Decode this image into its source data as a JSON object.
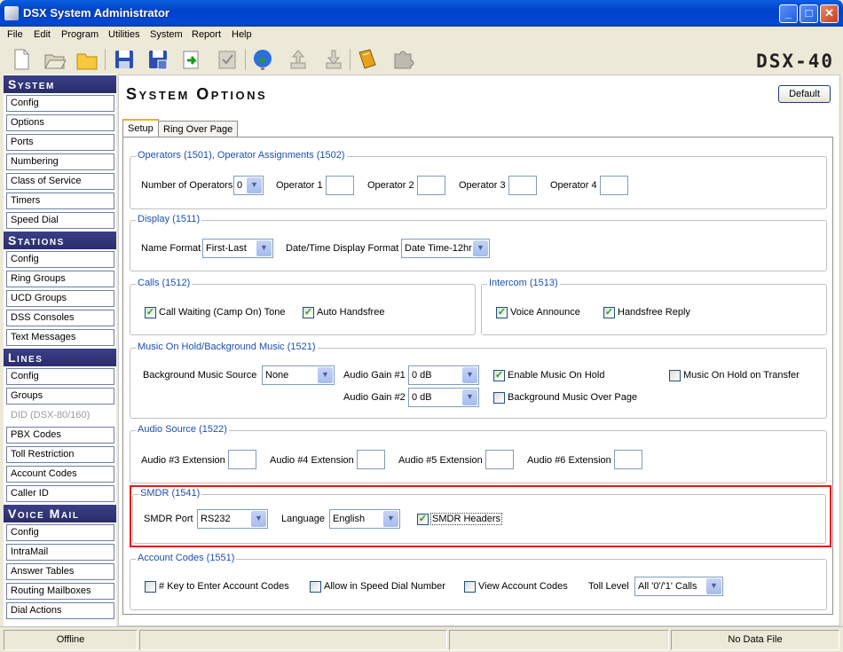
{
  "window": {
    "title": "DSX System Administrator",
    "minimize": "_",
    "maximize": "□",
    "close": "✕"
  },
  "menu": [
    "File",
    "Edit",
    "Program",
    "Utilities",
    "System",
    "Report",
    "Help"
  ],
  "toolbar": {
    "icons": [
      "new-file-icon",
      "open-folder-icon",
      "folder-icon",
      "save-icon",
      "save-as-icon",
      "export-icon",
      "checklist-icon",
      "globe-icon",
      "upload-icon",
      "download-icon",
      "book-icon",
      "puzzle-icon"
    ]
  },
  "brand": "DSX-40",
  "sidebar": {
    "system": {
      "title": "System",
      "items": [
        "Config",
        "Options",
        "Ports",
        "Numbering",
        "Class of Service",
        "Timers",
        "Speed Dial"
      ]
    },
    "stations": {
      "title": "Stations",
      "items": [
        "Config",
        "Ring Groups",
        "UCD Groups",
        "DSS Consoles",
        "Text Messages"
      ]
    },
    "lines": {
      "title": "Lines",
      "items": [
        "Config",
        "Groups",
        "DID (DSX-80/160)",
        "PBX Codes",
        "Toll Restriction",
        "Account Codes",
        "Caller ID"
      ]
    },
    "voicemail": {
      "title": "Voice Mail",
      "items": [
        "Config",
        "IntraMail",
        "Answer Tables",
        "Routing Mailboxes",
        "Dial Actions"
      ]
    }
  },
  "page": {
    "title": "System Options",
    "default_button": "Default"
  },
  "tabs": [
    "Setup",
    "Ring Over Page"
  ],
  "operators": {
    "title": "Operators (1501), Operator Assignments (1502)",
    "num_label": "Number of Operators",
    "num_value": "0",
    "op1": "Operator 1",
    "op2": "Operator 2",
    "op3": "Operator 3",
    "op4": "Operator 4"
  },
  "display": {
    "title": "Display (1511)",
    "name_format_label": "Name Format",
    "name_format_value": "First-Last",
    "datetime_label": "Date/Time Display Format",
    "datetime_value": "Date Time-12hr"
  },
  "calls": {
    "title": "Calls (1512)",
    "camp_on": "Call Waiting (Camp On) Tone",
    "auto_handsfree": "Auto Handsfree"
  },
  "intercom": {
    "title": "Intercom (1513)",
    "voice_announce": "Voice Announce",
    "handsfree_reply": "Handsfree Reply"
  },
  "music": {
    "title": "Music On Hold/Background Music (1521)",
    "bg_source_label": "Background Music Source",
    "bg_source_value": "None",
    "gain1_label": "Audio Gain #1",
    "gain1_value": "0 dB",
    "gain2_label": "Audio Gain #2",
    "gain2_value": "0 dB",
    "enable_moh": "Enable Music On Hold",
    "bg_over_page": "Background Music Over Page",
    "moh_transfer": "Music On Hold on Transfer"
  },
  "audio_source": {
    "title": "Audio Source (1522)",
    "ext3": "Audio #3 Extension",
    "ext4": "Audio #4 Extension",
    "ext5": "Audio #5 Extension",
    "ext6": "Audio #6 Extension"
  },
  "smdr": {
    "title": "SMDR (1541)",
    "port_label": "SMDR Port",
    "port_value": "RS232",
    "lang_label": "Language",
    "lang_value": "English",
    "headers": "SMDR Headers"
  },
  "account_codes": {
    "title": "Account Codes (1551)",
    "key_enter": "# Key to Enter Account Codes",
    "speed_dial": "Allow in Speed Dial Number",
    "view": "View Account Codes",
    "toll_label": "Toll Level",
    "toll_value": "All '0'/'1' Calls"
  },
  "status": {
    "left": "Offline",
    "right": "No Data File"
  },
  "colors": {
    "highlight": "#e01b1b",
    "group_label": "#1c4fb0",
    "sidebar_header": "#2f327a"
  }
}
